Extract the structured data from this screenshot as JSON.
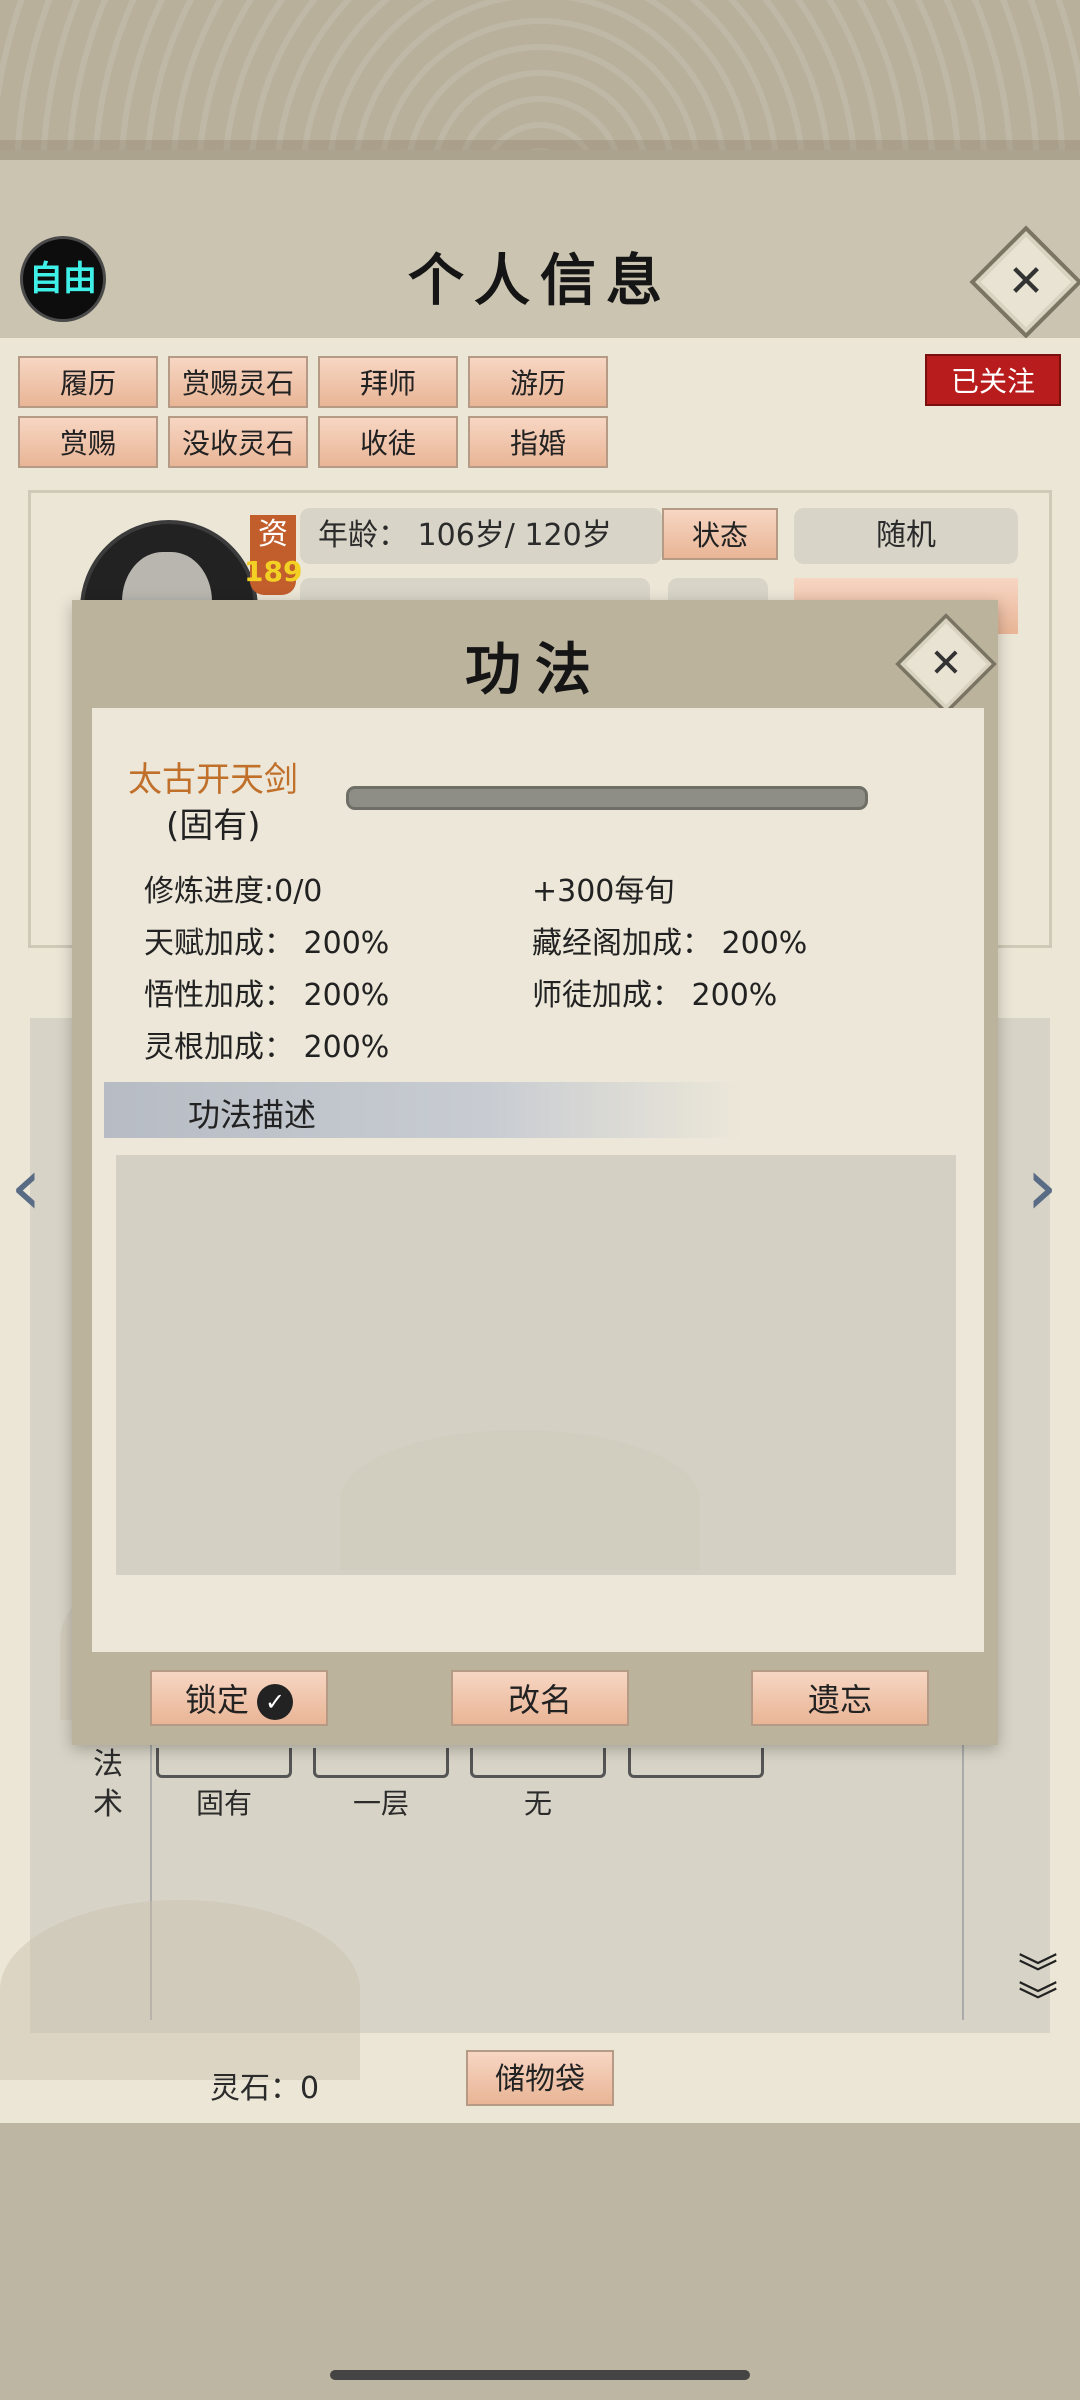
{
  "header": {
    "title": "个人信息",
    "free_badge": "自由",
    "followed_label": "已关注"
  },
  "tabs": {
    "row1": [
      "履历",
      "赏赐灵石",
      "拜师",
      "游历"
    ],
    "row2": [
      "赏赐",
      "没收灵石",
      "收徒",
      "指婚"
    ]
  },
  "profile": {
    "stat_label": "资",
    "stat_value": "189",
    "age_text": "年龄：  106岁/ 120岁",
    "status_button": "状态",
    "random_label": "随机"
  },
  "skills_panel": {
    "category_label": "法\n术",
    "slot_labels": [
      "固有",
      "一层",
      "无",
      ""
    ]
  },
  "footer": {
    "stone_text": "灵石：0",
    "bag_button": "储物袋"
  },
  "modal": {
    "title": "功法",
    "skill_name": "太古开天剑",
    "skill_type": "(固有)",
    "progress": 0,
    "stats": {
      "cultivation": "修炼进度:0/0",
      "per_turn": "+300每旬",
      "talent": "天赋加成：  200%",
      "library": "藏经阁加成：  200%",
      "insight": "悟性加成：  200%",
      "mentor": "师徒加成：     200%",
      "root": "灵根加成：  200%"
    },
    "description_label": "功法描述",
    "description_text": "",
    "buttons": {
      "lock": "锁定",
      "rename": "改名",
      "forget": "遗忘"
    }
  },
  "colors": {
    "accent_orange": "#c0702a",
    "followed_red": "#b91c1c",
    "free_cyan": "#3ff0e8"
  }
}
